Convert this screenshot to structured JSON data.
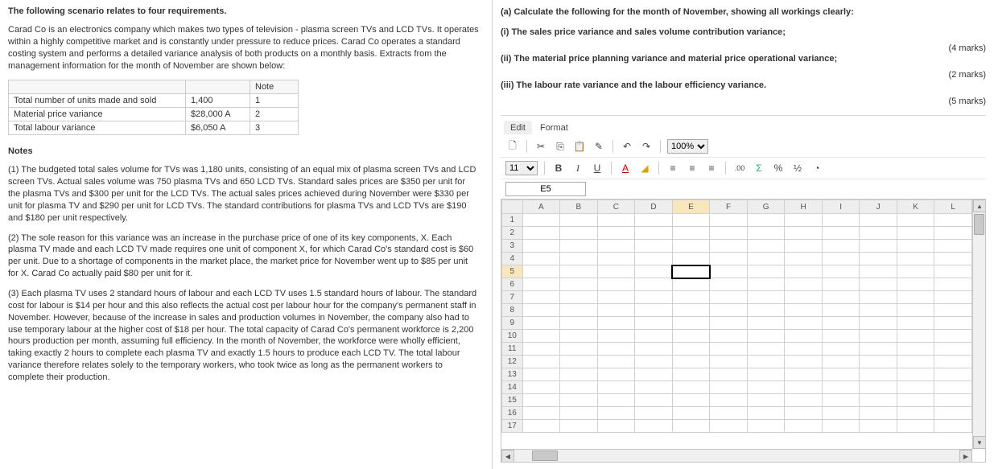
{
  "left": {
    "title": "The following scenario relates to four requirements.",
    "intro": "Carad Co is an electronics company which makes two types of television - plasma screen TVs and LCD TVs. It operates within a highly competitive market and is constantly under pressure to reduce prices. Carad Co operates a standard costing system and performs a detailed variance analysis of both products on a monthly basis. Extracts from the management information for the month of November are shown below:",
    "table": {
      "col_note": "Note",
      "rows": [
        {
          "label": "Total number of units made and sold",
          "val": "1,400",
          "note": "1"
        },
        {
          "label": "Material price variance",
          "val": "$28,000 A",
          "note": "2"
        },
        {
          "label": "Total labour variance",
          "val": "$6,050 A",
          "note": "3"
        }
      ]
    },
    "notes_h": "Notes",
    "note1": "(1)  The budgeted total sales volume for TVs was 1,180 units, consisting of an equal mix of plasma screen TVs and LCD screen TVs. Actual sales volume was 750 plasma TVs and 650 LCD TVs. Standard sales prices are $350 per unit for the plasma TVs and $300 per unit for the LCD TVs. The actual sales prices achieved during November were $330 per unit for plasma TV and $290 per unit for LCD TVs. The standard contributions for plasma TVs and LCD TVs are $190 and $180 per unit respectively.",
    "note2": "(2)  The sole reason for this variance was an increase in the purchase price of one of its key components, X. Each plasma TV made and each LCD TV made requires one unit of component X, for which Carad Co's standard cost is $60 per unit. Due to a shortage of components in the market place, the market price for November went up to $85 per unit for X. Carad Co actually paid $80 per unit for it.",
    "note3": "(3)  Each plasma TV uses 2 standard hours of labour and each LCD TV uses 1.5 standard hours of labour. The standard cost for labour is $14 per hour and this also reflects the actual cost per labour hour for the company's permanent staff in November. However, because of the increase in sales and production volumes in November, the company also had to use temporary labour at the higher cost of $18 per hour.  The total capacity of Carad Co's permanent workforce is 2,200 hours production per month, assuming full efficiency. In the month of November, the workforce were wholly efficient, taking exactly 2 hours to complete each plasma TV and exactly 1.5 hours to produce each LCD TV. The total labour variance therefore relates solely to the temporary workers, who took twice as long as the permanent workers to complete their production."
  },
  "right": {
    "a_head": "(a) Calculate the following for the month of November, showing all workings clearly:",
    "i": {
      "text": "(i) The sales price variance and sales volume contribution variance;",
      "marks": "(4 marks)"
    },
    "ii": {
      "text": "(ii) The material price planning variance and material price operational variance;",
      "marks": "(2 marks)"
    },
    "iii": {
      "text": "(iii) The labour rate variance and the labour efficiency variance.",
      "marks": "(5 marks)"
    }
  },
  "toolbar": {
    "tab_edit": "Edit",
    "tab_format": "Format",
    "zoom": "100%",
    "font_size": "11",
    "cell_ref": "E5"
  },
  "spreadsheet": {
    "cols": [
      "A",
      "B",
      "C",
      "D",
      "E",
      "F",
      "G",
      "H",
      "I",
      "J",
      "K",
      "L"
    ],
    "rows": [
      "1",
      "2",
      "3",
      "4",
      "5",
      "6",
      "7",
      "8",
      "9",
      "10",
      "11",
      "12",
      "13",
      "14",
      "15",
      "16",
      "17"
    ],
    "selected_col": "E",
    "selected_row": "5"
  },
  "icons": {
    "new": "🗋",
    "cut": "✂",
    "copy": "⎘",
    "paste": "📋",
    "brush": "✎",
    "undo": "↶",
    "redo": "↷",
    "bold": "B",
    "italic": "I",
    "underline": "U",
    "font_color": "A",
    "fill": "◢",
    "align_l": "≡",
    "align_c": "≡",
    "align_r": "≡",
    "decimals": ".00",
    "sum": "Σ",
    "percent": "%",
    "fraction": "½",
    "clock": "◔"
  }
}
